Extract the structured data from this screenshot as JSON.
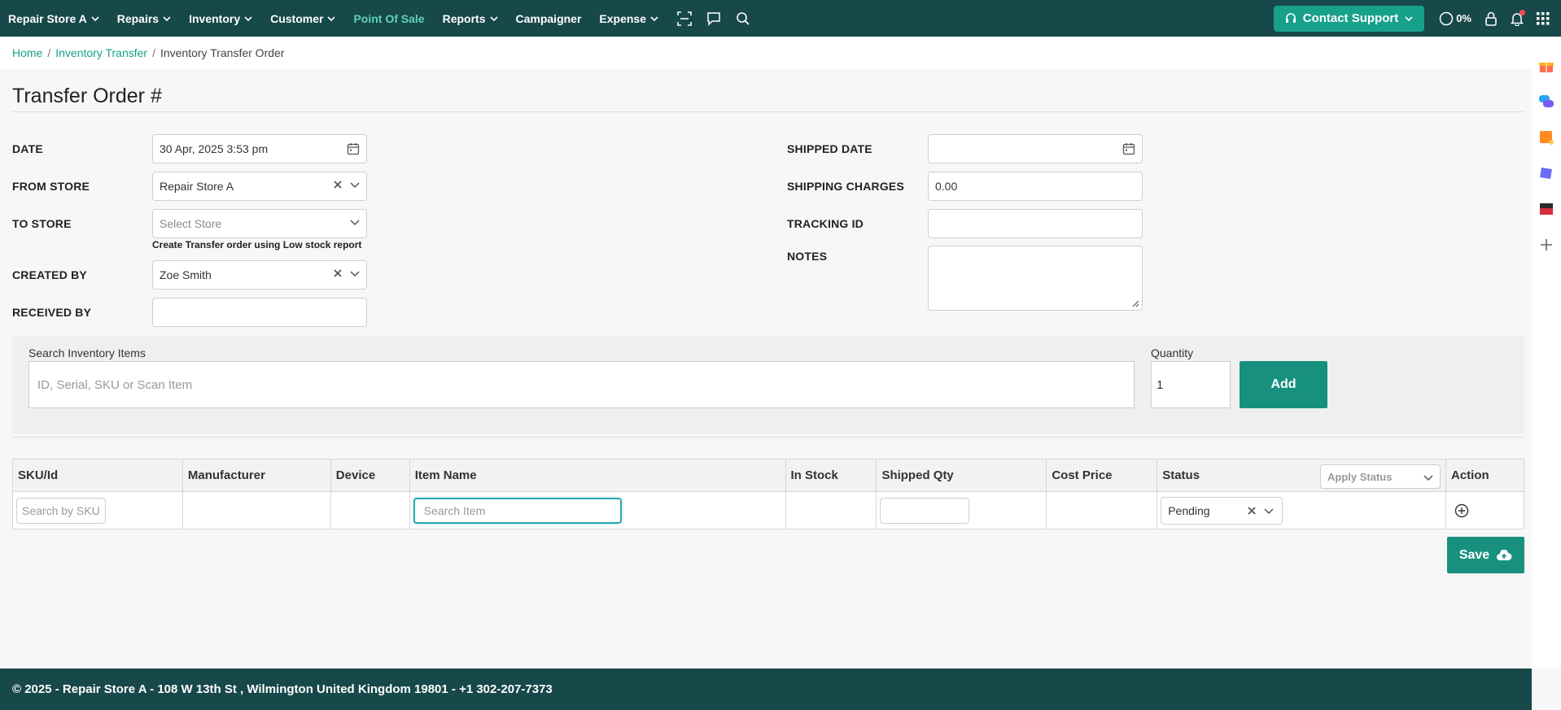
{
  "nav": {
    "items": [
      {
        "label": "Repair Store A",
        "chevron": true
      },
      {
        "label": "Repairs",
        "chevron": true
      },
      {
        "label": "Inventory",
        "chevron": true
      },
      {
        "label": "Customer",
        "chevron": true
      },
      {
        "label": "Point Of Sale",
        "chevron": false
      },
      {
        "label": "Reports",
        "chevron": true
      },
      {
        "label": "Campaigner",
        "chevron": false
      },
      {
        "label": "Expense",
        "chevron": true
      }
    ],
    "contact_support": "Contact Support",
    "progress_label": "0%",
    "colors": {
      "bar": "#17484a",
      "accent": "#17a08a",
      "active": "#5fd3b8"
    }
  },
  "breadcrumb": {
    "home": "Home",
    "section": "Inventory Transfer",
    "current": "Inventory Transfer Order"
  },
  "page": {
    "title": "Transfer Order #"
  },
  "form": {
    "date_label": "DATE",
    "date_value": "30 Apr, 2025  3:53 pm",
    "from_store_label": "FROM STORE",
    "from_store_value": "Repair Store A",
    "to_store_label": "TO STORE",
    "to_store_placeholder": "Select Store",
    "low_stock_link": "Create Transfer order using Low stock report",
    "created_by_label": "CREATED BY",
    "created_by_value": "Zoe Smith",
    "received_by_label": "RECEIVED BY",
    "received_by_value": "",
    "shipped_date_label": "SHIPPED DATE",
    "shipped_date_value": "",
    "shipping_charges_label": "SHIPPING CHARGES",
    "shipping_charges_value": "0.00",
    "tracking_id_label": "TRACKING ID",
    "tracking_id_value": "",
    "notes_label": "NOTES",
    "notes_value": ""
  },
  "search": {
    "label": "Search Inventory Items",
    "placeholder": "ID, Serial, SKU or Scan Item",
    "quantity_label": "Quantity",
    "quantity_value": "1",
    "add_label": "Add"
  },
  "table": {
    "headers": [
      "SKU/Id",
      "Manufacturer",
      "Device",
      "Item Name",
      "In Stock",
      "Shipped Qty",
      "Cost Price",
      "Status",
      "Action"
    ],
    "apply_status_placeholder": "Apply Status",
    "row": {
      "sku_placeholder": "Search by SKU",
      "item_placeholder": "Search Item",
      "status_value": "Pending"
    }
  },
  "save_label": "Save",
  "footer": {
    "text": "© 2025 - Repair Store A - 108 W 13th St , Wilmington United Kingdom 19801 - +1 302-207-7373"
  }
}
